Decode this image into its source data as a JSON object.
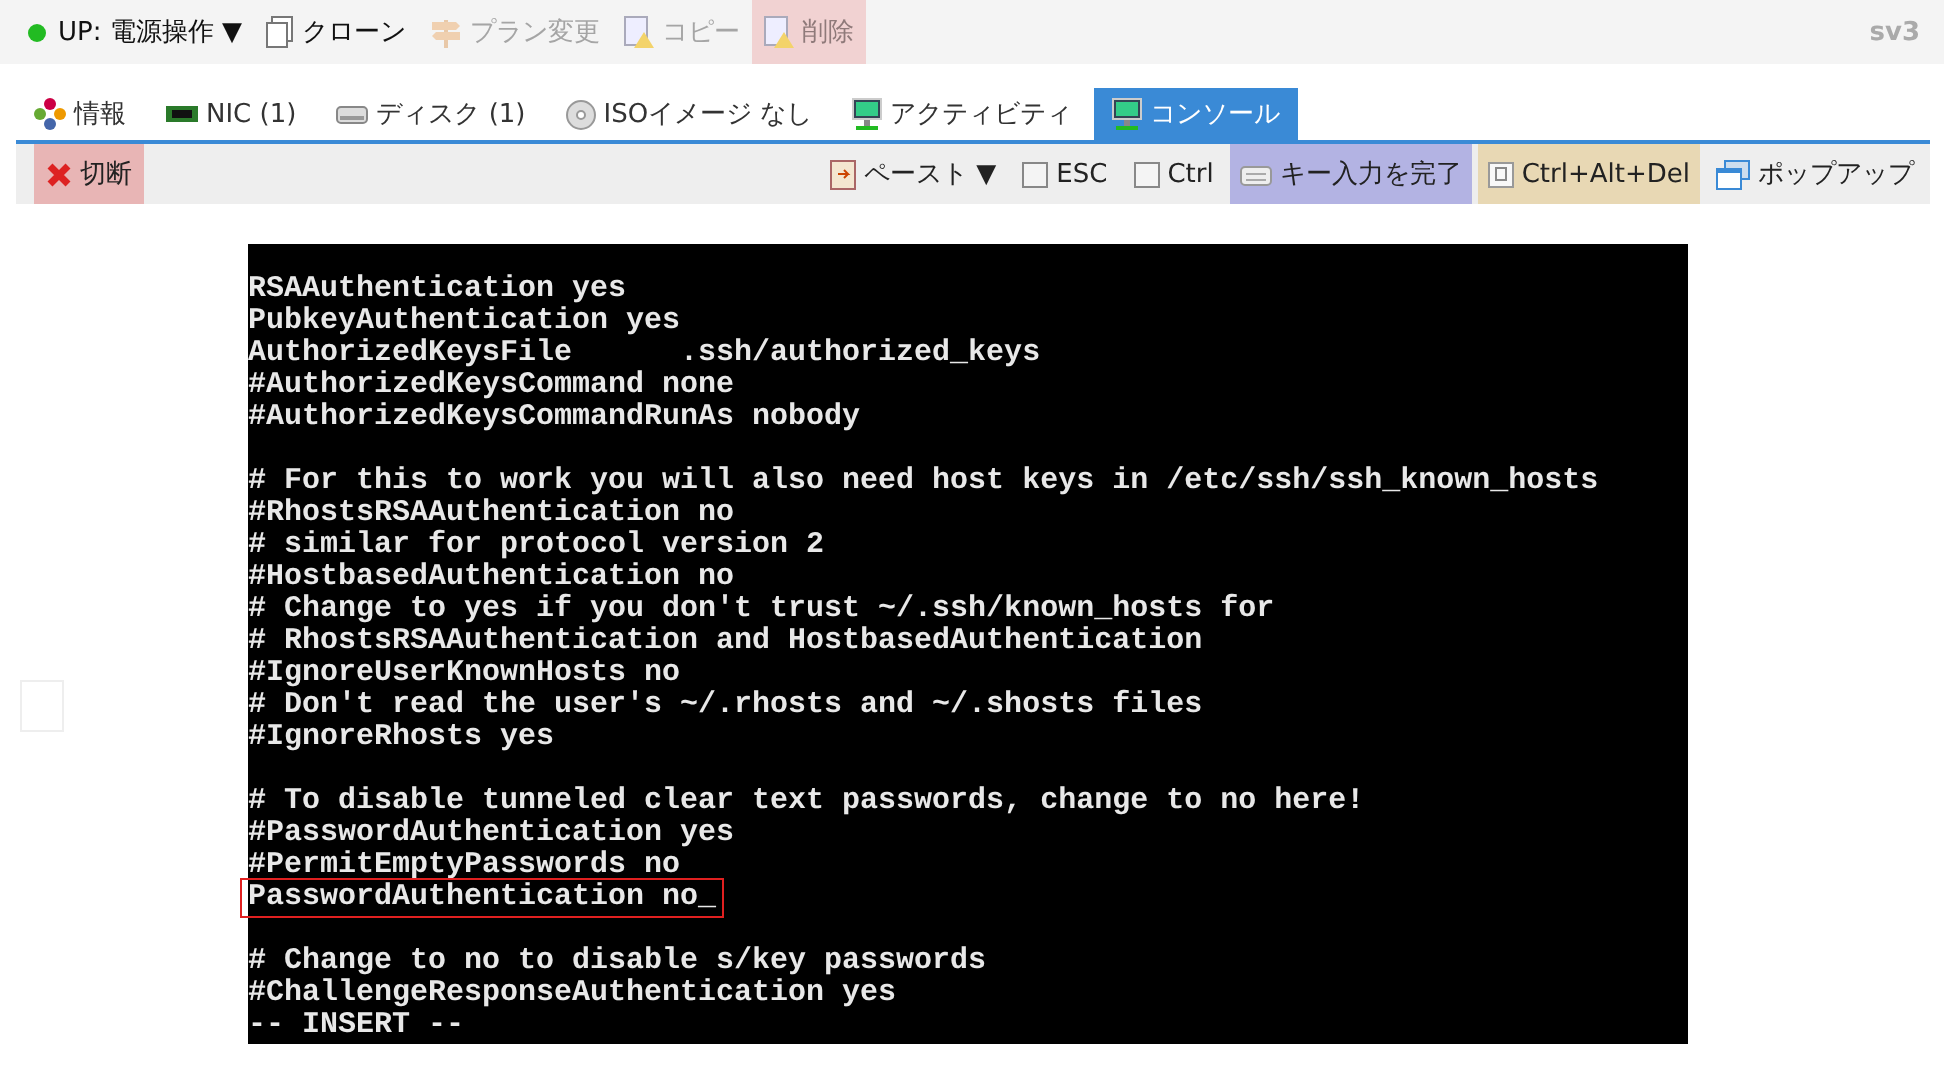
{
  "top_bar": {
    "status": {
      "label": "UP: 電源操作 ▼",
      "color": "#22bb22"
    },
    "actions": [
      {
        "label": "クローン",
        "disabled": false,
        "kind": "plain"
      },
      {
        "label": "プラン変更",
        "disabled": true,
        "kind": "plain"
      },
      {
        "label": "コピー",
        "disabled": true,
        "kind": "plain"
      },
      {
        "label": "削除",
        "disabled": true,
        "kind": "danger"
      }
    ],
    "server_name": "sv3"
  },
  "tabs": [
    {
      "label": "情報",
      "selected": false
    },
    {
      "label": "NIC (1)",
      "selected": false
    },
    {
      "label": "ディスク (1)",
      "selected": false
    },
    {
      "label": "ISOイメージ なし",
      "selected": false
    },
    {
      "label": "アクティビティ",
      "selected": false
    },
    {
      "label": "コンソール",
      "selected": true
    }
  ],
  "console_toolbar": {
    "disconnect": {
      "label": "切断"
    },
    "controls": [
      {
        "kind": "menu",
        "label": "ペースト ▼"
      },
      {
        "kind": "checkbox",
        "label": "ESC",
        "checked": false
      },
      {
        "kind": "checkbox",
        "label": "Ctrl",
        "checked": false
      },
      {
        "kind": "keys",
        "label": "キー入力を完了"
      },
      {
        "kind": "special",
        "label": "Ctrl+Alt+Del"
      },
      {
        "kind": "popup",
        "label": "ポップアップ"
      }
    ]
  },
  "terminal": {
    "lines": [
      {
        "text": "RSAAuthentication yes",
        "highlighted": false
      },
      {
        "text": "PubkeyAuthentication yes",
        "highlighted": false
      },
      {
        "text": "AuthorizedKeysFile      .ssh/authorized_keys",
        "highlighted": false
      },
      {
        "text": "#AuthorizedKeysCommand none",
        "highlighted": false
      },
      {
        "text": "#AuthorizedKeysCommandRunAs nobody",
        "highlighted": false
      },
      {
        "highlighted": false
      },
      {
        "text": "# For this to work you will also need host keys in /etc/ssh/ssh_known_hosts",
        "highlighted": false
      },
      {
        "text": "#RhostsRSAAuthentication no",
        "highlighted": false
      },
      {
        "text": "# similar for protocol version 2",
        "highlighted": false
      },
      {
        "text": "#HostbasedAuthentication no",
        "highlighted": false
      },
      {
        "text": "# Change to yes if you don't trust ~/.ssh/known_hosts for",
        "highlighted": false
      },
      {
        "text": "# RhostsRSAAuthentication and HostbasedAuthentication",
        "highlighted": false
      },
      {
        "text": "#IgnoreUserKnownHosts no",
        "highlighted": false
      },
      {
        "text": "# Don't read the user's ~/.rhosts and ~/.shosts files",
        "highlighted": false
      },
      {
        "text": "#IgnoreRhosts yes",
        "highlighted": false
      },
      {
        "highlighted": false
      },
      {
        "text": "# To disable tunneled clear text passwords, change to no here!",
        "highlighted": false
      },
      {
        "text": "#PasswordAuthentication yes",
        "highlighted": false
      },
      {
        "text": "#PermitEmptyPasswords no",
        "highlighted": false
      },
      {
        "text": "PasswordAuthentication no_",
        "highlighted": true
      },
      {
        "highlighted": false
      },
      {
        "text": "# Change to no to disable s/key passwords",
        "highlighted": false
      },
      {
        "text": "#ChallengeResponseAuthentication yes",
        "highlighted": false
      },
      {
        "text": "-- INSERT --",
        "highlighted": false
      }
    ]
  }
}
